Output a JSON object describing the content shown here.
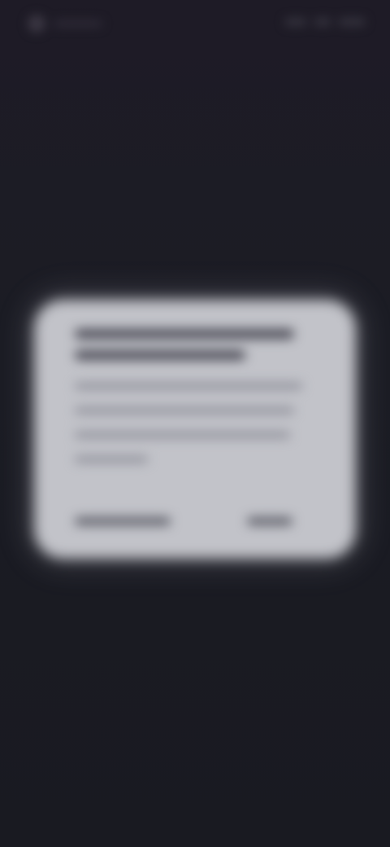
{
  "status_bar": {
    "left_icon": "app-icon",
    "right_icons": [
      "signal-icon",
      "wifi-icon",
      "battery-icon"
    ]
  },
  "dialog": {
    "title": "",
    "body": "",
    "negative_button": "",
    "positive_button": ""
  },
  "colors": {
    "background": "#1a1b22",
    "dialog": "#c2c3c9"
  }
}
